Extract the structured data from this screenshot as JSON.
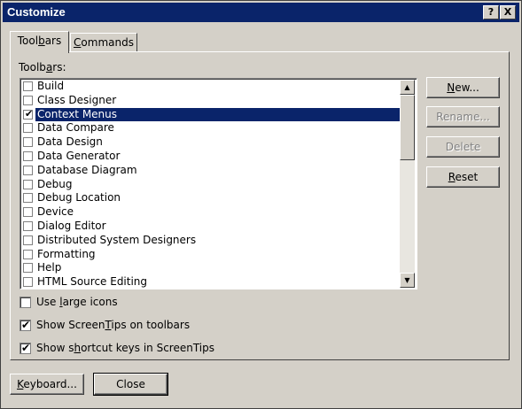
{
  "window": {
    "title": "Customize",
    "help_glyph": "?",
    "close_glyph": "X"
  },
  "tabs": [
    {
      "pre": "Tool",
      "acc": "b",
      "post": "ars"
    },
    {
      "pre": "",
      "acc": "C",
      "post": "ommands"
    }
  ],
  "toolbars_label": {
    "pre": "Toolb",
    "acc": "a",
    "post": "rs:"
  },
  "toolbar_items": [
    {
      "label": "Build",
      "checked": false,
      "selected": false
    },
    {
      "label": "Class Designer",
      "checked": false,
      "selected": false
    },
    {
      "label": "Context Menus",
      "checked": true,
      "selected": true
    },
    {
      "label": "Data Compare",
      "checked": false,
      "selected": false
    },
    {
      "label": "Data Design",
      "checked": false,
      "selected": false
    },
    {
      "label": "Data Generator",
      "checked": false,
      "selected": false
    },
    {
      "label": "Database Diagram",
      "checked": false,
      "selected": false
    },
    {
      "label": "Debug",
      "checked": false,
      "selected": false
    },
    {
      "label": "Debug Location",
      "checked": false,
      "selected": false
    },
    {
      "label": "Device",
      "checked": false,
      "selected": false
    },
    {
      "label": "Dialog Editor",
      "checked": false,
      "selected": false
    },
    {
      "label": "Distributed System Designers",
      "checked": false,
      "selected": false
    },
    {
      "label": "Formatting",
      "checked": false,
      "selected": false
    },
    {
      "label": "Help",
      "checked": false,
      "selected": false
    },
    {
      "label": "HTML Source Editing",
      "checked": false,
      "selected": false
    }
  ],
  "buttons": {
    "new": {
      "pre": "",
      "acc": "N",
      "post": "ew..."
    },
    "rename": {
      "label": "Rename..."
    },
    "delete": {
      "label": "Delete"
    },
    "reset": {
      "pre": "",
      "acc": "R",
      "post": "eset"
    },
    "keyboard": {
      "pre": "",
      "acc": "K",
      "post": "eyboard..."
    },
    "close": {
      "label": "Close"
    }
  },
  "options": {
    "large_icons": {
      "pre": "Use ",
      "acc": "l",
      "post": "arge icons",
      "checked": false
    },
    "screentips": {
      "pre": "Show Screen",
      "acc": "T",
      "post": "ips on toolbars",
      "checked": true
    },
    "shortcut_keys": {
      "pre": "Show s",
      "acc": "h",
      "post": "ortcut keys in ScreenTips",
      "checked": true
    }
  },
  "glyphs": {
    "check": "✔",
    "up_arrow": "▲",
    "down_arrow": "▼"
  }
}
